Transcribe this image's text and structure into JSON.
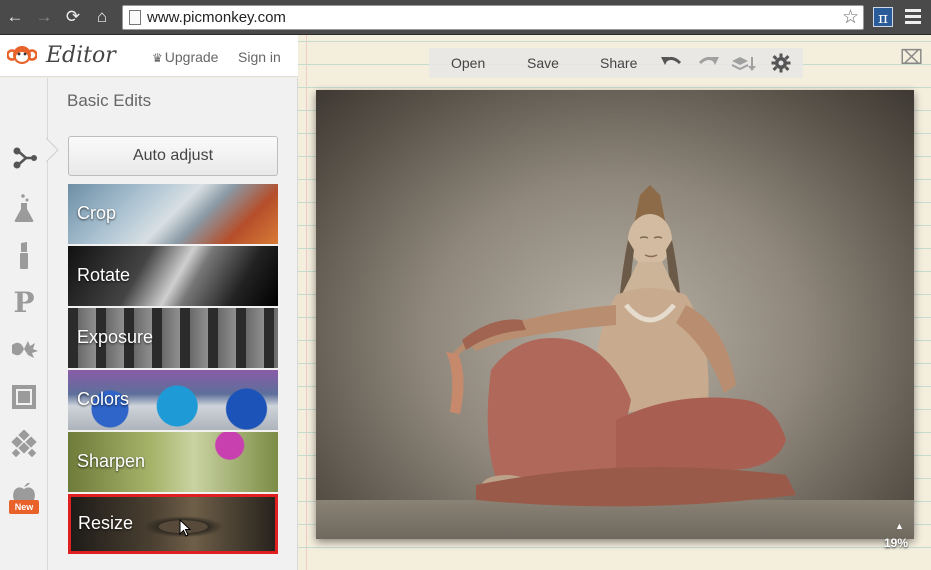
{
  "browser": {
    "url": "www.picmonkey.com",
    "back_icon": "arrow-left-icon",
    "forward_icon": "arrow-right-icon",
    "reload_icon": "reload-icon",
    "home_icon": "home-icon",
    "star_icon": "star-icon",
    "menu_icon": "menu-icon",
    "extension_glyph": "π"
  },
  "header": {
    "logo_text": "Editor",
    "upgrade_label": "Upgrade",
    "signin_label": "Sign in",
    "brand_color": "#e8622a"
  },
  "toolstrip": {
    "tools": [
      {
        "name": "basic-edits",
        "icon": "nodes-icon",
        "active": true
      },
      {
        "name": "effects",
        "icon": "flask-icon",
        "active": false
      },
      {
        "name": "touch-up",
        "icon": "lipstick-icon",
        "active": false
      },
      {
        "name": "text",
        "icon": "text-p-icon",
        "active": false
      },
      {
        "name": "overlays",
        "icon": "butterfly-icon",
        "active": false
      },
      {
        "name": "frames",
        "icon": "frame-icon",
        "active": false
      },
      {
        "name": "textures",
        "icon": "texture-icon",
        "active": false
      },
      {
        "name": "seasonal",
        "icon": "apple-icon",
        "active": false
      }
    ],
    "new_badge": "New"
  },
  "panel": {
    "title": "Basic Edits",
    "auto_adjust_label": "Auto adjust",
    "items": [
      {
        "label": "Crop"
      },
      {
        "label": "Rotate"
      },
      {
        "label": "Exposure"
      },
      {
        "label": "Colors"
      },
      {
        "label": "Sharpen"
      },
      {
        "label": "Resize",
        "highlighted": true
      }
    ],
    "highlight_color": "#e02020"
  },
  "toolbar": {
    "open_label": "Open",
    "save_label": "Save",
    "share_label": "Share",
    "undo_icon": "undo-icon",
    "redo_icon": "redo-icon",
    "layers_icon": "layers-icon",
    "settings_icon": "gear-icon"
  },
  "canvas": {
    "zoom_label": "19%"
  }
}
